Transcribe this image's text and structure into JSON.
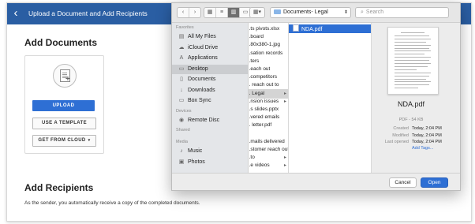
{
  "header": {
    "back_icon": "chevron-left-icon",
    "title": "Upload a Document and Add Recipients"
  },
  "add_documents": {
    "heading": "Add Documents",
    "upload_label": "UPLOAD",
    "template_label": "USE A TEMPLATE",
    "cloud_label": "GET FROM CLOUD",
    "cloud_caret": "▾"
  },
  "add_recipients": {
    "heading": "Add Recipients",
    "note": "As the sender, you automatically receive a copy of the completed documents."
  },
  "dialog": {
    "toolbar": {
      "back": "‹",
      "forward": "›",
      "path": "Documents- Legal",
      "search_placeholder": "Search"
    },
    "sidebar": {
      "favorites_label": "Favorites",
      "favorites": [
        {
          "label": "All My Files",
          "icon": "all-files-icon",
          "glyph": "▤"
        },
        {
          "label": "iCloud Drive",
          "icon": "cloud-icon",
          "glyph": "☁"
        },
        {
          "label": "Applications",
          "icon": "applications-icon",
          "glyph": "A"
        },
        {
          "label": "Desktop",
          "icon": "desktop-icon",
          "glyph": "▭",
          "selected": true
        },
        {
          "label": "Documents",
          "icon": "documents-icon",
          "glyph": "▯"
        },
        {
          "label": "Downloads",
          "icon": "downloads-icon",
          "glyph": "↓"
        },
        {
          "label": "Box Sync",
          "icon": "folder-icon",
          "glyph": "▭"
        }
      ],
      "devices_label": "Devices",
      "devices": [
        {
          "label": "Remote Disc",
          "icon": "disc-icon",
          "glyph": "◉"
        }
      ],
      "shared_label": "Shared",
      "media_label": "Media",
      "media": [
        {
          "label": "Music",
          "icon": "music-icon",
          "glyph": "♪"
        },
        {
          "label": "Photos",
          "icon": "camera-icon",
          "glyph": "▣"
        }
      ]
    },
    "column1": [
      {
        "label": "...ts pivots.xlsx"
      },
      {
        "label": "...board"
      },
      {
        "label": "...80x380-1.jpg"
      },
      {
        "label": "...sation records"
      },
      {
        "label": "...ters"
      },
      {
        "label": "...each out"
      },
      {
        "label": "...competitors"
      },
      {
        "label": "... reach out to"
      },
      {
        "label": "... Legal",
        "selected": true,
        "arrow": true
      },
      {
        "label": "...nsion issues",
        "arrow": true
      },
      {
        "label": "...s slides.pptx"
      },
      {
        "label": "...vered emails"
      },
      {
        "label": "... letter.pdf"
      },
      {
        "label": ""
      },
      {
        "label": "...mails delivered"
      },
      {
        "label": "...stomer reach out"
      },
      {
        "label": "...to",
        "arrow": true
      },
      {
        "label": "...e videos",
        "arrow": true
      }
    ],
    "column2": [
      {
        "label": "NDA.pdf",
        "selected": true
      }
    ],
    "preview": {
      "name": "NDA.pdf",
      "meta": "PDF - 54 KB",
      "rows": [
        {
          "key": "Created",
          "value": "Today, 2:04 PM"
        },
        {
          "key": "Modified",
          "value": "Today, 2:04 PM"
        },
        {
          "key": "Last opened",
          "value": "Today, 2:04 PM"
        }
      ],
      "add_tags": "Add Tags..."
    },
    "buttons": {
      "cancel": "Cancel",
      "open": "Open"
    }
  }
}
